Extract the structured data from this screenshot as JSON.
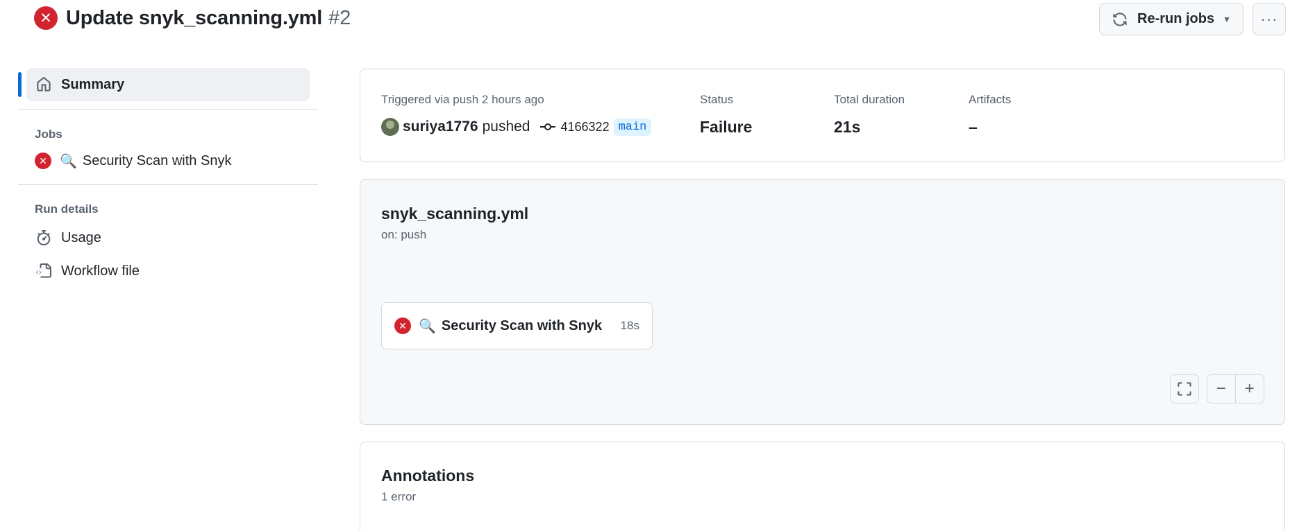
{
  "header": {
    "title": "Update snyk_scanning.yml",
    "run_number": "#2",
    "status_icon": "x-circle-fill-icon",
    "rerun_label": "Re-run jobs",
    "more_label": "···"
  },
  "sidebar": {
    "summary_label": "Summary",
    "jobs_heading": "Jobs",
    "jobs": [
      {
        "emoji": "🔍",
        "label": "Security Scan with Snyk",
        "status": "failure"
      }
    ],
    "run_details_heading": "Run details",
    "run_details": [
      {
        "label": "Usage",
        "icon": "stopwatch-icon"
      },
      {
        "label": "Workflow file",
        "icon": "file-code-icon"
      }
    ]
  },
  "summary": {
    "trigger_label": "Triggered via push 2 hours ago",
    "actor": "suriya1776",
    "action": "pushed",
    "commit": "4166322",
    "branch": "main",
    "status_label": "Status",
    "status_value": "Failure",
    "duration_label": "Total duration",
    "duration_value": "21s",
    "artifacts_label": "Artifacts",
    "artifacts_value": "–"
  },
  "graph": {
    "workflow_file": "snyk_scanning.yml",
    "trigger": "on: push",
    "job": {
      "emoji": "🔍",
      "name": "Security Scan with Snyk",
      "duration": "18s"
    },
    "zoom_out": "−",
    "zoom_in": "+"
  },
  "annotations": {
    "title": "Annotations",
    "count": "1 error"
  },
  "colors": {
    "failure": "#d1242f",
    "accent": "#0969da",
    "branch_bg": "#ddf4ff"
  }
}
